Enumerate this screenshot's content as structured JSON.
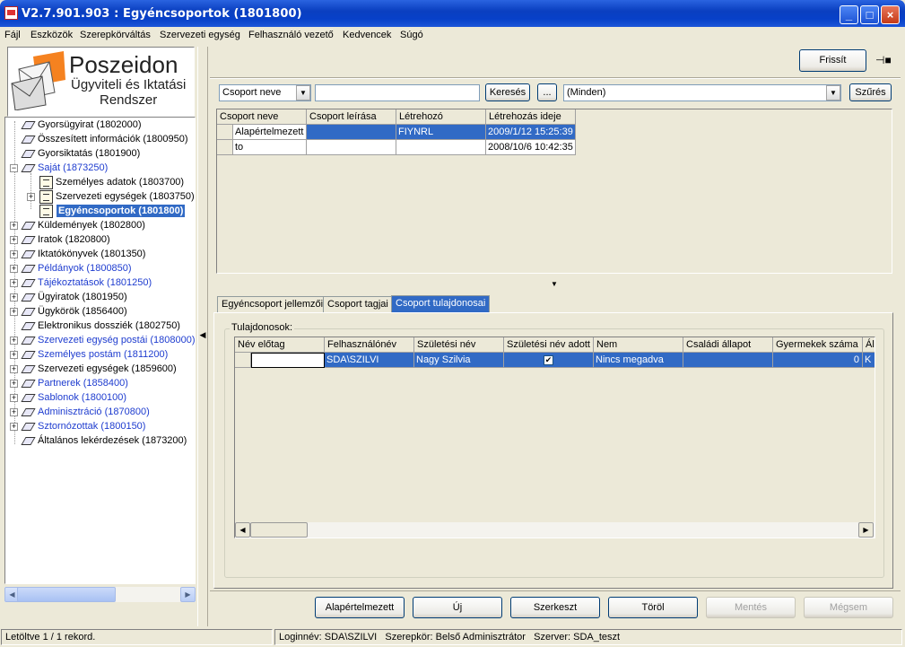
{
  "window": {
    "title": "V2.7.901.903 : Egyéncsoportok (1801800)",
    "min": "_",
    "max": "□",
    "close": "×"
  },
  "menu": [
    "Fájl",
    "Eszközök",
    "Szerepkörváltás",
    "Szervezeti egység",
    "Felhasználó vezető",
    "Kedvencek",
    "Súgó"
  ],
  "logo": {
    "name": "Poszeidon",
    "line1": "Ügyviteli és Iktatási",
    "line2": "Rendszer"
  },
  "tree": [
    {
      "label": "Gyorsügyirat (1802000)",
      "blue": false
    },
    {
      "label": "Összesített információk (1800950)",
      "blue": false
    },
    {
      "label": "Gyorsiktatás (1801900)",
      "blue": false
    },
    {
      "label": "Saját (1873250)",
      "blue": true
    },
    {
      "label": "Személyes adatok (1803700)",
      "blue": false
    },
    {
      "label": "Szervezeti egységek (1803750)",
      "blue": false
    },
    {
      "label": "Egyéncsoportok (1801800)",
      "blue": false
    },
    {
      "label": "Küldemények (1802800)",
      "blue": false
    },
    {
      "label": "Iratok (1820800)",
      "blue": false
    },
    {
      "label": "Iktatókönyvek (1801350)",
      "blue": false
    },
    {
      "label": "Példányok (1800850)",
      "blue": true
    },
    {
      "label": "Tájékoztatások (1801250)",
      "blue": true
    },
    {
      "label": "Ügyiratok (1801950)",
      "blue": false
    },
    {
      "label": "Ügykörök (1856400)",
      "blue": false
    },
    {
      "label": "Elektronikus dossziék (1802750)",
      "blue": false
    },
    {
      "label": "Szervezeti egység postái (1808000)",
      "blue": true
    },
    {
      "label": "Személyes postám (1811200)",
      "blue": true
    },
    {
      "label": "Szervezeti egységek (1859600)",
      "blue": false
    },
    {
      "label": "Partnerek (1858400)",
      "blue": true
    },
    {
      "label": "Sablonok (1800100)",
      "blue": true
    },
    {
      "label": "Adminisztráció (1870800)",
      "blue": true
    },
    {
      "label": "Sztornózottak (1800150)",
      "blue": true
    },
    {
      "label": "Általános lekérdezések (1873200)",
      "blue": false
    }
  ],
  "toolbar": {
    "refresh": "Frissít",
    "pin": "⊣■"
  },
  "filter": {
    "field": "Csoport neve",
    "value": "",
    "search": "Keresés",
    "more": "...",
    "scope": "(Minden)",
    "filter": "Szűrés"
  },
  "groups": {
    "columns": [
      "Csoport neve",
      "Csoport leírása",
      "Létrehozó",
      "Létrehozás ideje"
    ],
    "rows": [
      [
        "Alapértelmezett",
        "",
        "FIYNRL",
        "2009/1/12 15:25:39"
      ],
      [
        "to",
        "",
        "",
        "2008/10/6 10:42:35"
      ]
    ]
  },
  "splitter": "▼",
  "tabs": [
    "Egyéncsoport jellemzői",
    "Csoport tagjai",
    "Csoport tulajdonosai"
  ],
  "owners": {
    "legend": "Tulajdonosok:",
    "columns": [
      "Név előtag",
      "Felhasználónév",
      "Születési név",
      "Születési név adott",
      "Nem",
      "Családi állapot",
      "Gyermekek száma",
      "Ál"
    ],
    "row": {
      "prefix": "",
      "username": "SDA\\SZILVI",
      "birthname": "Nagy Szilvia",
      "birthname_given": true,
      "gender": "Nincs megadva",
      "marital": "",
      "children": "0",
      "extra": "K"
    }
  },
  "buttons": {
    "default": "Alapértelmezett",
    "new": "Új",
    "edit": "Szerkeszt",
    "delete": "Töröl",
    "save": "Mentés",
    "cancel": "Mégsem"
  },
  "status": {
    "records": "Letöltve 1 / 1 rekord.",
    "login": "Loginnév: SDA\\SZILVI",
    "role": "Szerepkör: Belső Adminisztrátor",
    "server": "Szerver: SDA_teszt"
  }
}
